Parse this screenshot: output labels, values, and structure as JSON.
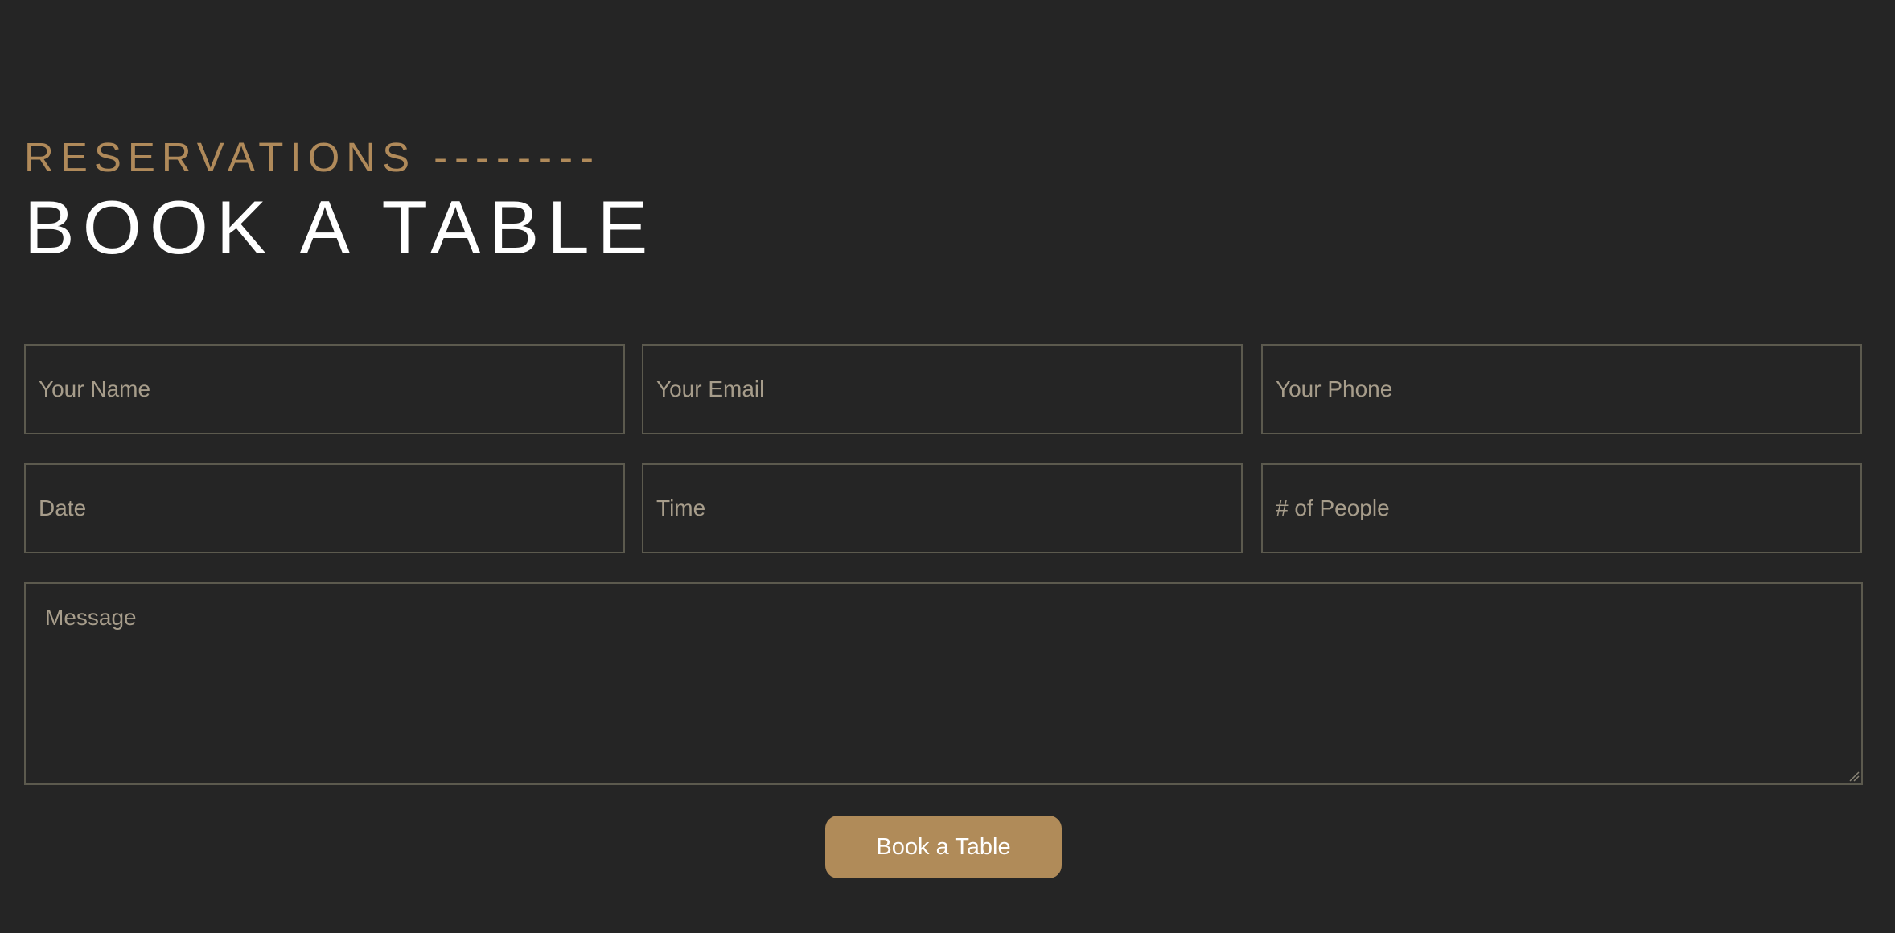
{
  "section": {
    "eyebrow": "RESERVATIONS",
    "eyebrow_dashes": "--------",
    "title": "BOOK A TABLE"
  },
  "form": {
    "name_placeholder": "Your Name",
    "email_placeholder": "Your Email",
    "phone_placeholder": "Your Phone",
    "date_placeholder": "Date",
    "time_placeholder": "Time",
    "people_placeholder": "# of People",
    "message_placeholder": "Message",
    "submit_label": "Book a Table"
  },
  "colors": {
    "background": "#252525",
    "accent": "#b08b59",
    "field_border": "#5c5a4e",
    "placeholder": "#a79d8b",
    "title": "#ffffff"
  }
}
